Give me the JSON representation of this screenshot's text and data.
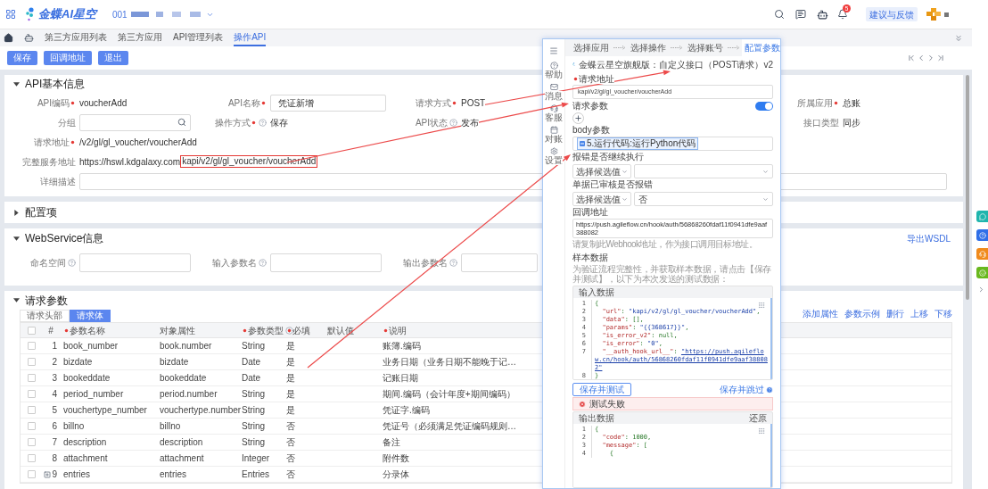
{
  "header": {
    "logo": "金蝶AI星空",
    "account": "001",
    "feedback_button": "建议与反馈",
    "notification_count": "5"
  },
  "tabs": [
    {
      "label": "第三方应用列表",
      "selected": false
    },
    {
      "label": "第三方应用",
      "selected": false
    },
    {
      "label": "API管理列表",
      "selected": false
    },
    {
      "label": "操作API",
      "selected": true
    }
  ],
  "toolbar": {
    "buttons": [
      "保存",
      "回调地址",
      "退出"
    ]
  },
  "basic_info": {
    "title": "API基本信息",
    "expanded": true,
    "rows": [
      [
        {
          "label": "API编码",
          "required": true,
          "help": false,
          "kind": "text",
          "value": "voucherAdd"
        },
        {
          "label": "API名称",
          "required": true,
          "help": false,
          "kind": "input",
          "value": "凭证新增"
        },
        {
          "label": "请求方式",
          "required": true,
          "help": false,
          "kind": "text",
          "value": "POST"
        },
        {
          "label": "所属应用",
          "required": true,
          "help": false,
          "kind": "text",
          "value": "总账"
        }
      ],
      [
        {
          "label": "分组",
          "required": false,
          "help": false,
          "kind": "search"
        },
        {
          "label": "操作方式",
          "required": true,
          "help": true,
          "kind": "text",
          "value": "保存"
        },
        {
          "label": "API状态",
          "required": false,
          "help": true,
          "kind": "text",
          "value": "发布"
        },
        {
          "label": "接口类型",
          "required": false,
          "help": false,
          "kind": "text",
          "value": "同步"
        }
      ],
      [
        {
          "label": "请求地址",
          "required": true,
          "help": false,
          "kind": "text",
          "value": "/v2/gl/gl_voucher/voucherAdd"
        }
      ],
      [
        {
          "label": "完整服务地址",
          "required": false,
          "help": false,
          "kind": "url",
          "value": "https://hswl.kdgalaxy.com",
          "highlight": "kapi/v2/gl/gl_voucher/voucherAdd"
        }
      ],
      [
        {
          "label": "详细描述",
          "required": false,
          "help": false,
          "kind": "textarea"
        }
      ]
    ]
  },
  "config": {
    "title": "配置项",
    "expanded": false
  },
  "webservice": {
    "title": "WebService信息",
    "expanded": true,
    "link": "导出WSDL",
    "fields": [
      {
        "label": "命名空间",
        "help": true
      },
      {
        "label": "输入参数名",
        "help": true
      },
      {
        "label": "输出参数名",
        "help": true
      }
    ]
  },
  "request_params": {
    "title": "请求参数",
    "expanded": true,
    "tabs": [
      {
        "label": "请求头部",
        "selected": false
      },
      {
        "label": "请求体",
        "selected": true
      }
    ],
    "select_all": {
      "checked": false
    },
    "actions": [
      "添加属性",
      "参数示例",
      "删行",
      "上移",
      "下移"
    ],
    "columns": [
      {
        "label": "#",
        "required": false,
        "help": false
      },
      {
        "label": "参数名称",
        "required": true,
        "help": false
      },
      {
        "label": "对象属性",
        "required": false,
        "help": false
      },
      {
        "label": "参数类型",
        "required": true,
        "help": true
      },
      {
        "label": "必填",
        "required": true,
        "help": false
      },
      {
        "label": "默认值",
        "required": false,
        "help": false
      },
      {
        "label": "说明",
        "required": true,
        "help": false
      }
    ],
    "rows": [
      {
        "cells": [
          "1",
          "book_number",
          "book.number",
          "String",
          "是",
          "",
          "账簿.编码"
        ],
        "expandable": false,
        "checked": false
      },
      {
        "cells": [
          "2",
          "bizdate",
          "bizdate",
          "Date",
          "是",
          "",
          "业务日期（业务日期不能晚于记…"
        ],
        "expandable": false,
        "checked": false
      },
      {
        "cells": [
          "3",
          "bookeddate",
          "bookeddate",
          "Date",
          "是",
          "",
          "记账日期"
        ],
        "expandable": false,
        "checked": false
      },
      {
        "cells": [
          "4",
          "period_number",
          "period.number",
          "String",
          "是",
          "",
          "期间.编码（会计年度+期间编码）"
        ],
        "expandable": false,
        "checked": false
      },
      {
        "cells": [
          "5",
          "vouchertype_number",
          "vouchertype.number",
          "String",
          "是",
          "",
          "凭证字.编码"
        ],
        "expandable": false,
        "checked": false
      },
      {
        "cells": [
          "6",
          "billno",
          "billno",
          "String",
          "否",
          "",
          "凭证号（必须满足凭证编码规则…"
        ],
        "expandable": false,
        "checked": false
      },
      {
        "cells": [
          "7",
          "description",
          "description",
          "String",
          "否",
          "",
          "备注"
        ],
        "expandable": false,
        "checked": false
      },
      {
        "cells": [
          "8",
          "attachment",
          "attachment",
          "Integer",
          "否",
          "",
          "附件数"
        ],
        "expandable": false,
        "checked": false
      },
      {
        "cells": [
          "9",
          "entries",
          "entries",
          "Entries",
          "否",
          "",
          "分录体"
        ],
        "expandable": true,
        "checked": false
      }
    ]
  },
  "flow_panel": {
    "sidebar": [
      {
        "label": "帮助",
        "kind": "help"
      },
      {
        "label": "消息",
        "kind": "message"
      },
      {
        "label": "客服",
        "kind": "service"
      },
      {
        "label": "对账",
        "kind": "calendar"
      },
      {
        "label": "设置",
        "kind": "settings"
      }
    ],
    "steps": [
      {
        "label": "选择应用",
        "selected": false
      },
      {
        "label": "选择操作",
        "selected": false
      },
      {
        "label": "选择账号",
        "selected": false
      },
      {
        "label": "配置参数",
        "selected": true
      }
    ],
    "title": "金蝶云星空旗舰版：自定义接口（POST请求）v2",
    "url": {
      "label": "请求地址",
      "required": true,
      "value": "kapi/v2/gl/gl_voucher/voucherAdd"
    },
    "params": {
      "label": "请求参数",
      "on": true
    },
    "body": {
      "label": "body参数",
      "chip": "5.运行代码:运行Python代码"
    },
    "selects": [
      {
        "label": "报错是否继续执行",
        "mode": "选择候选值"
      },
      {
        "label": "单据已审核是否报错",
        "mode": "选择候选值",
        "value": "否"
      }
    ],
    "callback": {
      "label": "回调地址",
      "value": "https://push.agileflow.cn/hook/auth/56868260fdaf11f0941dfe9aaf388082",
      "hint": "请复制此Webhook地址，作为接口调用目标地址。"
    },
    "sample": {
      "label": "样本数据",
      "description": "为验证流程完整性，并获取样本数据，请点击【保存并测试】，以下为本次发送的测试数据：",
      "input_title": "输入数据",
      "input_lines": [
        {
          "num": "1",
          "text": "{"
        },
        {
          "num": "2",
          "text": "  \"url\": \"kapi/v2/gl/gl_voucher/voucherAdd\","
        },
        {
          "num": "3",
          "text": "  \"data\": [],"
        },
        {
          "num": "4",
          "text": "  \"params\": \"{{368617}}\","
        },
        {
          "num": "5",
          "text": "  \"is_error_v2\": null,"
        },
        {
          "num": "6",
          "text": "  \"is_error\": \"0\","
        },
        {
          "num": "7",
          "text": "  \"__auth_hook_url__\": \"https://push.agileflow.cn/hook/auth/56868260fdaf11f0941dfe9aaf388082\""
        },
        {
          "num": "8",
          "text": "}"
        }
      ],
      "test_button": "保存并测试",
      "skip_link": "保存并跳过",
      "error": "测试失败",
      "output_title": "输出数据",
      "restore": "还原",
      "output_lines": [
        {
          "num": "1",
          "text": "{"
        },
        {
          "num": "2",
          "text": "  \"code\": 1000,"
        },
        {
          "num": "3",
          "text": "  \"message\": ["
        },
        {
          "num": "4",
          "text": "    {"
        }
      ]
    }
  }
}
